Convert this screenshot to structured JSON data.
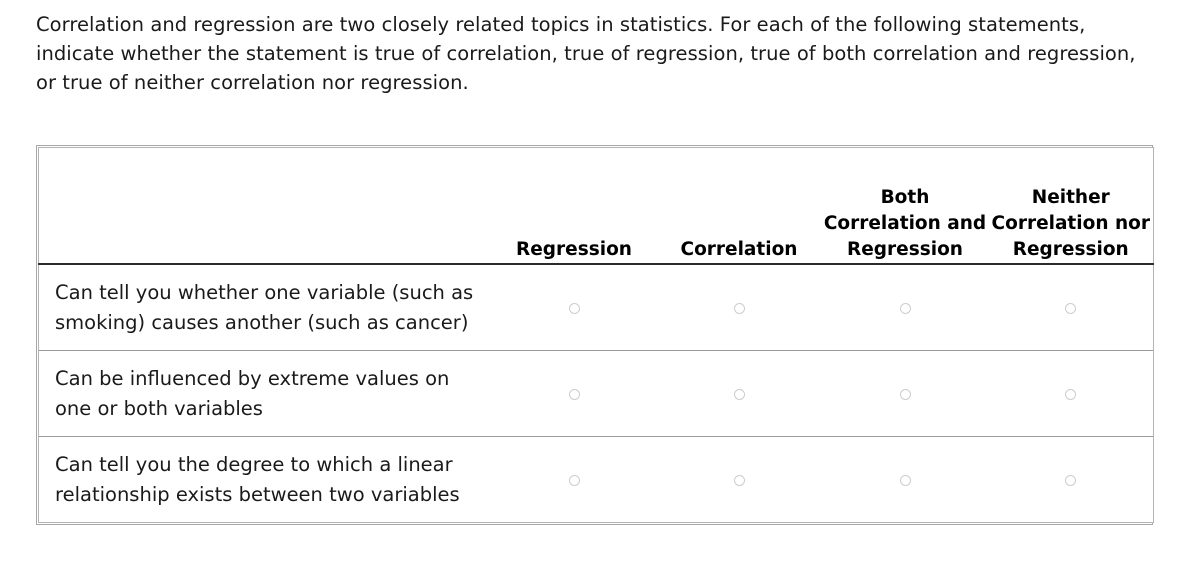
{
  "intro": {
    "text": "Correlation and regression are two closely related topics in statistics. For each of the following statements, indicate whether the statement is true of correlation, true of regression, true of both correlation and regression, or true of neither correlation nor regression."
  },
  "table": {
    "statement_column_header": "",
    "columns": [
      {
        "label": "Regression"
      },
      {
        "label": "Correlation"
      },
      {
        "label": "Both Correlation and Regression"
      },
      {
        "label": "Neither Correlation nor Regression"
      }
    ],
    "rows": [
      {
        "statement": "Can tell you whether one variable (such as smoking) causes another (such as cancer)",
        "selected": null
      },
      {
        "statement": "Can be influenced by extreme values on one or both variables",
        "selected": null
      },
      {
        "statement": "Can tell you the degree to which a linear relationship exists between two variables",
        "selected": null
      }
    ]
  },
  "colors": {
    "page_background": "#ffffff",
    "text": "#1a1a1a",
    "header_text": "#000000",
    "table_border": "#b4b4b4",
    "row_divider": "#9a9a9a",
    "header_rule": "#2b2b2b",
    "radio_border": "#cdcdcd"
  }
}
